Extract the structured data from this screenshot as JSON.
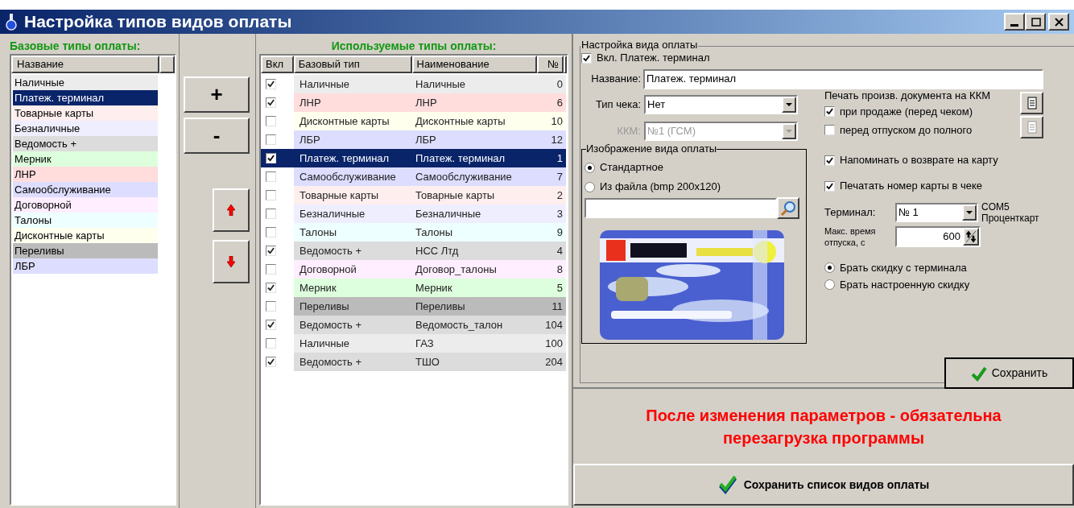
{
  "window": {
    "title": "Настройка типов видов оплаты"
  },
  "base_types": {
    "heading": "Базовые типы оплаты:",
    "columns": [
      "Название"
    ],
    "items": [
      {
        "name": "Наличные",
        "color": "#ececec",
        "selected": false
      },
      {
        "name": "Платеж. терминал",
        "selected": true
      },
      {
        "name": "Товарные карты",
        "color": "#ffeeee",
        "selected": false
      },
      {
        "name": "Безналичные",
        "color": "#eeeeff",
        "selected": false
      },
      {
        "name": "Ведомость +",
        "color": "#dcdcdc",
        "selected": false
      },
      {
        "name": "Мерник",
        "color": "#ddffdd",
        "selected": false
      },
      {
        "name": "ЛНР",
        "color": "#ffdddd",
        "selected": false
      },
      {
        "name": "Самообслуживание",
        "color": "#ddddff",
        "selected": false
      },
      {
        "name": "Договорной",
        "color": "#ffeeff",
        "selected": false
      },
      {
        "name": "Талоны",
        "color": "#eeffff",
        "selected": false
      },
      {
        "name": "Дисконтные карты",
        "color": "#ffffee",
        "selected": false
      },
      {
        "name": "Переливы",
        "color": "#bbbbbb",
        "selected": false
      },
      {
        "name": "ЛБР",
        "color": "#ddddff",
        "selected": false
      }
    ]
  },
  "list_buttons": [
    "+",
    "-"
  ],
  "used_types": {
    "heading": "Используемые типы оплаты:",
    "columns": [
      "Вкл",
      "Базовый тип",
      "Наименование",
      "№"
    ],
    "rows": [
      {
        "checked": true,
        "base_type": "Наличные",
        "name": "Наличные",
        "number": "0",
        "color": "#ececec",
        "selected": false
      },
      {
        "checked": true,
        "base_type": "ЛНР",
        "name": "ЛНР",
        "number": "6",
        "color": "#ffdddd",
        "selected": false
      },
      {
        "checked": false,
        "base_type": "Дисконтные карты",
        "name": "Дисконтные карты",
        "number": "10",
        "color": "#ffffee",
        "selected": false
      },
      {
        "checked": false,
        "base_type": "ЛБР",
        "name": "ЛБР",
        "number": "12",
        "color": "#ddddff",
        "selected": false
      },
      {
        "checked": true,
        "base_type": "Платеж. терминал",
        "name": "Платеж. терминал",
        "number": "1",
        "selected": true
      },
      {
        "checked": false,
        "base_type": "Самообслуживание",
        "name": "Самообслуживание",
        "number": "7",
        "color": "#ddddff",
        "selected": false
      },
      {
        "checked": false,
        "base_type": "Товарные карты",
        "name": "Товарные карты",
        "number": "2",
        "color": "#ffeeee",
        "selected": false
      },
      {
        "checked": false,
        "base_type": "Безналичные",
        "name": "Безналичные",
        "number": "3",
        "color": "#eeeeff",
        "selected": false
      },
      {
        "checked": false,
        "base_type": "Талоны",
        "name": "Талоны",
        "number": "9",
        "color": "#eeffff",
        "selected": false
      },
      {
        "checked": true,
        "base_type": "Ведомость +",
        "name": "НСС Лтд",
        "number": "4",
        "color": "#dcdcdc",
        "selected": false
      },
      {
        "checked": false,
        "base_type": "Договорной",
        "name": "Договор_талоны",
        "number": "8",
        "color": "#ffeeff",
        "selected": false
      },
      {
        "checked": true,
        "base_type": "Мерник",
        "name": "Мерник",
        "number": "5",
        "color": "#ddffdd",
        "selected": false
      },
      {
        "checked": false,
        "base_type": "Переливы",
        "name": "Переливы",
        "number": "11",
        "color": "#bbbbbb",
        "selected": false
      },
      {
        "checked": true,
        "base_type": "Ведомость +",
        "name": "Ведомость_талон",
        "number": "104",
        "color": "#dcdcdc",
        "selected": false
      },
      {
        "checked": false,
        "base_type": "Наличные",
        "name": "ГАЗ",
        "number": "100",
        "color": "#ececec",
        "selected": false
      },
      {
        "checked": true,
        "base_type": "Ведомость +",
        "name": "ТШО",
        "number": "204",
        "color": "#dcdcdc",
        "selected": false
      }
    ]
  },
  "settings": {
    "legend": "Настройка вида оплаты",
    "enabled": {
      "label": "Вкл. Платеж. терминал",
      "checked": true
    },
    "name": {
      "label": "Название:",
      "value": "Платеж. терминал"
    },
    "receipt_type": {
      "label": "Тип чека:",
      "value": "Нет",
      "disabled": false
    },
    "kkm": {
      "label": "ККМ:",
      "value": "№1 (ГСМ)",
      "disabled": true
    },
    "image": {
      "legend": "Изображение вида оплаты",
      "options": [
        {
          "label": "Стандартное",
          "selected": true
        },
        {
          "label": "Из файла (bmp 200x120)",
          "selected": false
        }
      ]
    },
    "print_doc": {
      "heading": "Печать произв. документа на ККМ",
      "options": [
        {
          "label": "при продаже (перед чеком)",
          "checked": true
        },
        {
          "label": "перед отпуском до полного",
          "checked": false
        }
      ]
    },
    "options": [
      {
        "label": "Напоминать о возврате на карту",
        "checked": true
      },
      {
        "label": "Печатать номер карты в чеке",
        "checked": true
      }
    ],
    "terminal": {
      "label": "Терминал:",
      "value": "№ 1",
      "port": "COM5",
      "provider": "Проценткарт"
    },
    "max_time": {
      "label": "Макс. время отпуска, с",
      "value": "600"
    },
    "discount": [
      {
        "label": "Брать скидку с терминала",
        "selected": true
      },
      {
        "label": "Брать настроенную скидку",
        "selected": false
      }
    ],
    "save": "Сохранить"
  },
  "notice": "После изменения параметров - обязательна перезагрузка программы",
  "save_list": "Сохранить список видов оплаты"
}
